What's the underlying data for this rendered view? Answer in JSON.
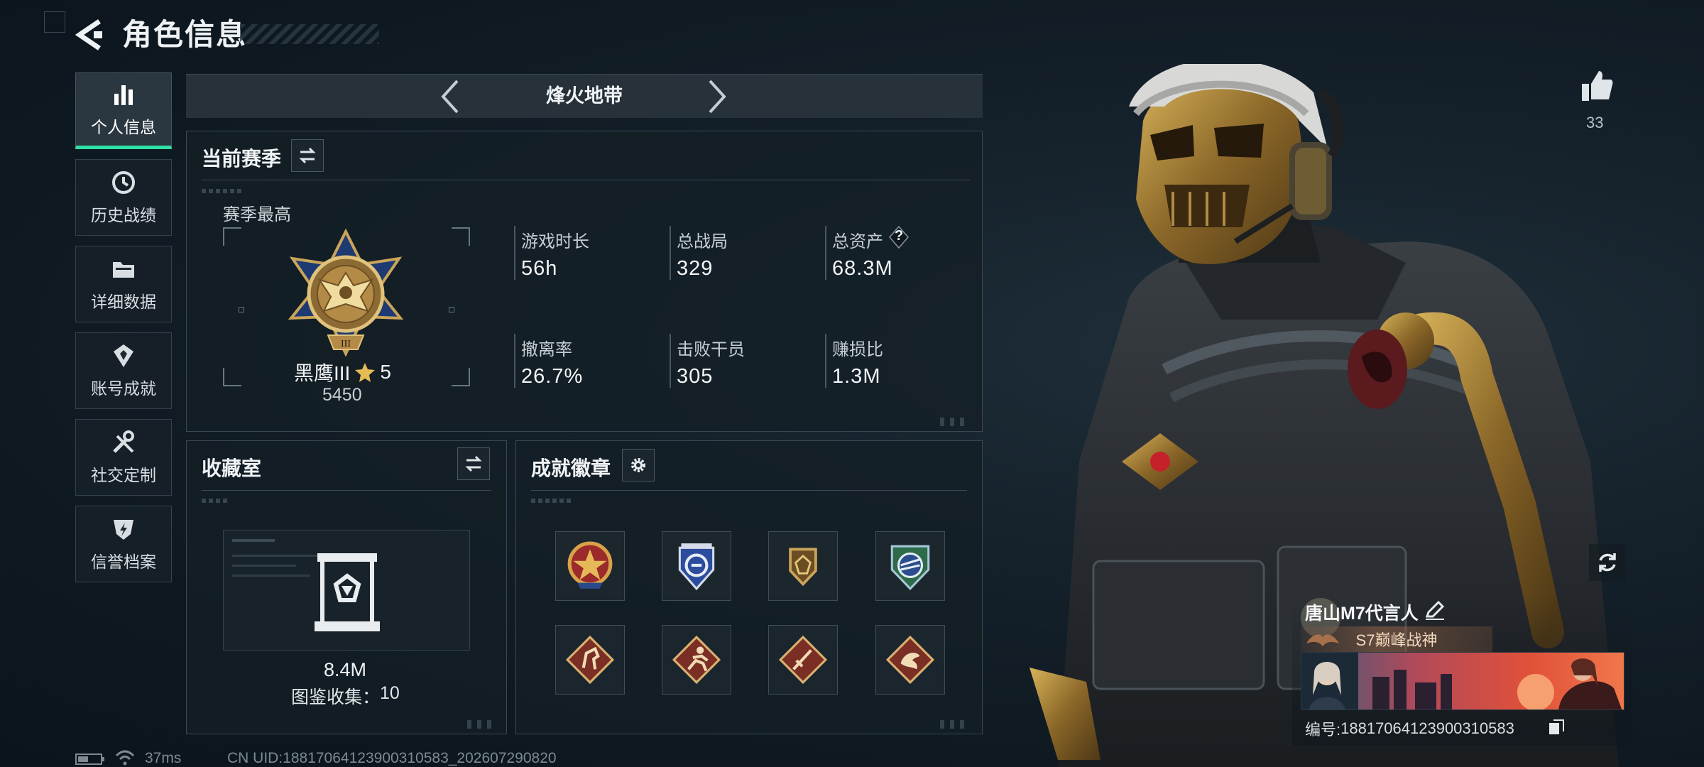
{
  "header": {
    "title": "角色信息"
  },
  "sidebar": {
    "items": [
      {
        "label": "个人信息",
        "active": true,
        "icon": "bar-chart-icon"
      },
      {
        "label": "历史战绩",
        "active": false,
        "icon": "history-clock-icon"
      },
      {
        "label": "详细数据",
        "active": false,
        "icon": "folder-icon"
      },
      {
        "label": "账号成就",
        "active": false,
        "icon": "achievement-emblem-icon"
      },
      {
        "label": "社交定制",
        "active": false,
        "icon": "tools-icon"
      },
      {
        "label": "信誉档案",
        "active": false,
        "icon": "reputation-shield-icon"
      }
    ]
  },
  "mode": {
    "name": "烽火地带"
  },
  "season": {
    "title": "当前赛季",
    "best_label": "赛季最高",
    "rank_name": "黑鹰III",
    "rank_stars": "5",
    "rank_points": "5450",
    "stats": [
      {
        "label": "游戏时长",
        "value": "56h"
      },
      {
        "label": "总战局",
        "value": "329"
      },
      {
        "label": "总资产",
        "value": "68.3M",
        "help": "?"
      },
      {
        "label": "撤离率",
        "value": "26.7%"
      },
      {
        "label": "击败干员",
        "value": "305"
      },
      {
        "label": "赚损比",
        "value": "1.3M"
      }
    ]
  },
  "collection": {
    "title": "收藏室",
    "value": "8.4M",
    "catalog_label": "图鉴收集：",
    "catalog_count": "10"
  },
  "badges": {
    "title": "成就徽章",
    "items": [
      "red-star-badge-icon",
      "blue-shield-badge-icon",
      "gold-crest-badge-icon",
      "green-wing-badge-icon",
      "horse-diamond-badge-icon",
      "runner-diamond-badge-icon",
      "sword-diamond-badge-icon",
      "dragon-diamond-badge-icon"
    ]
  },
  "status": {
    "ping": "37ms",
    "uid": "CN UID:18817064123900310583_202607290820"
  },
  "player": {
    "likes": "33",
    "name": "唐山M7代言人",
    "title": "S7巅峰战神",
    "id_label": "编号:",
    "id_value": "18817064123900310583"
  },
  "colors": {
    "accent": "#2fe0a5",
    "gold": "#c9a45a",
    "panel_border": "#3a4853"
  }
}
